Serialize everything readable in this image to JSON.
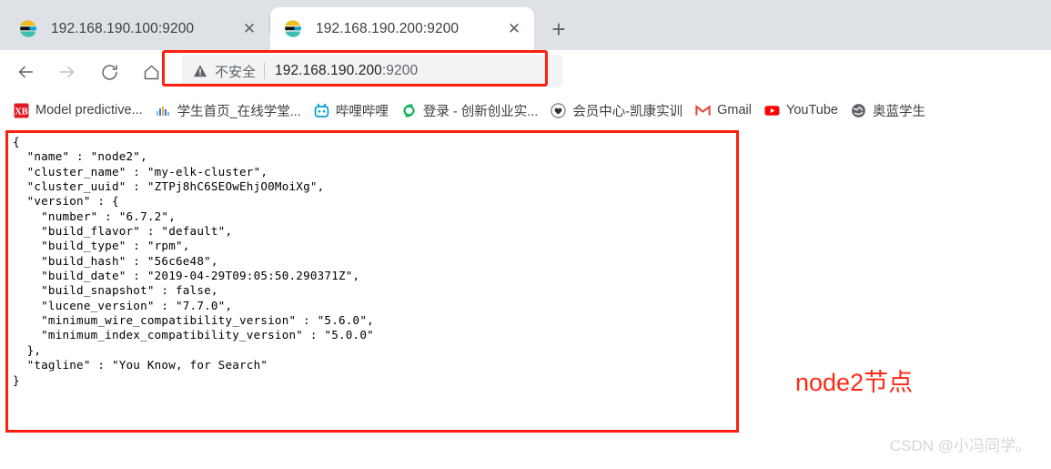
{
  "browser": {
    "tabs": [
      {
        "title": "192.168.190.100:9200",
        "favicon": "elasticsearch-favicon",
        "active": false,
        "close_glyph": "✕"
      },
      {
        "title": "192.168.190.200:9200",
        "favicon": "elasticsearch-favicon",
        "active": true,
        "close_glyph": "✕"
      }
    ],
    "new_tab_glyph": "+",
    "nav": {
      "back_glyph": "←",
      "forward_glyph": "→",
      "reload_glyph": "⟳",
      "home_glyph": "⌂"
    },
    "omnibox": {
      "security_icon": "warning-triangle-icon",
      "security_label": "不安全",
      "url_host": "192.168.190.200",
      "url_port": ":9200",
      "full_url": "192.168.190.200:9200"
    },
    "bookmarks": [
      {
        "label": "Model predictive...",
        "icon": "xb-icon"
      },
      {
        "label": "学生首页_在线学堂...",
        "icon": "bars-icon"
      },
      {
        "label": "哔哩哔哩",
        "icon": "bilibili-icon"
      },
      {
        "label": "登录 - 创新创业实...",
        "icon": "swirl-icon"
      },
      {
        "label": "会员中心-凯康实训",
        "icon": "heart-badge-icon"
      },
      {
        "label": "Gmail",
        "icon": "gmail-icon"
      },
      {
        "label": "YouTube",
        "icon": "youtube-icon"
      },
      {
        "label": "奥蓝学生",
        "icon": "globe-icon"
      }
    ]
  },
  "page": {
    "json_body": "{\n  \"name\" : \"node2\",\n  \"cluster_name\" : \"my-elk-cluster\",\n  \"cluster_uuid\" : \"ZTPj8hC6SEOwEhjO0MoiXg\",\n  \"version\" : {\n    \"number\" : \"6.7.2\",\n    \"build_flavor\" : \"default\",\n    \"build_type\" : \"rpm\",\n    \"build_hash\" : \"56c6e48\",\n    \"build_date\" : \"2019-04-29T09:05:50.290371Z\",\n    \"build_snapshot\" : false,\n    \"lucene_version\" : \"7.7.0\",\n    \"minimum_wire_compatibility_version\" : \"5.6.0\",\n    \"minimum_index_compatibility_version\" : \"5.0.0\"\n  },\n  \"tagline\" : \"You Know, for Search\"\n}",
    "json_fields": {
      "name": "node2",
      "cluster_name": "my-elk-cluster",
      "cluster_uuid": "ZTPj8hC6SEOwEhjO0MoiXg",
      "version": {
        "number": "6.7.2",
        "build_flavor": "default",
        "build_type": "rpm",
        "build_hash": "56c6e48",
        "build_date": "2019-04-29T09:05:50.290371Z",
        "build_snapshot": "false",
        "lucene_version": "7.7.0",
        "minimum_wire_compatibility_version": "5.6.0",
        "minimum_index_compatibility_version": "5.0.0"
      },
      "tagline": "You Know, for Search"
    },
    "annotation": "node2节点",
    "watermark": "CSDN @小冯同学。"
  },
  "colors": {
    "highlight_red": "#ff1f0f",
    "annotation_red": "#ff2a15",
    "tabstrip_bg": "#dee1e6",
    "omnibox_bg": "#f1f3f4"
  }
}
